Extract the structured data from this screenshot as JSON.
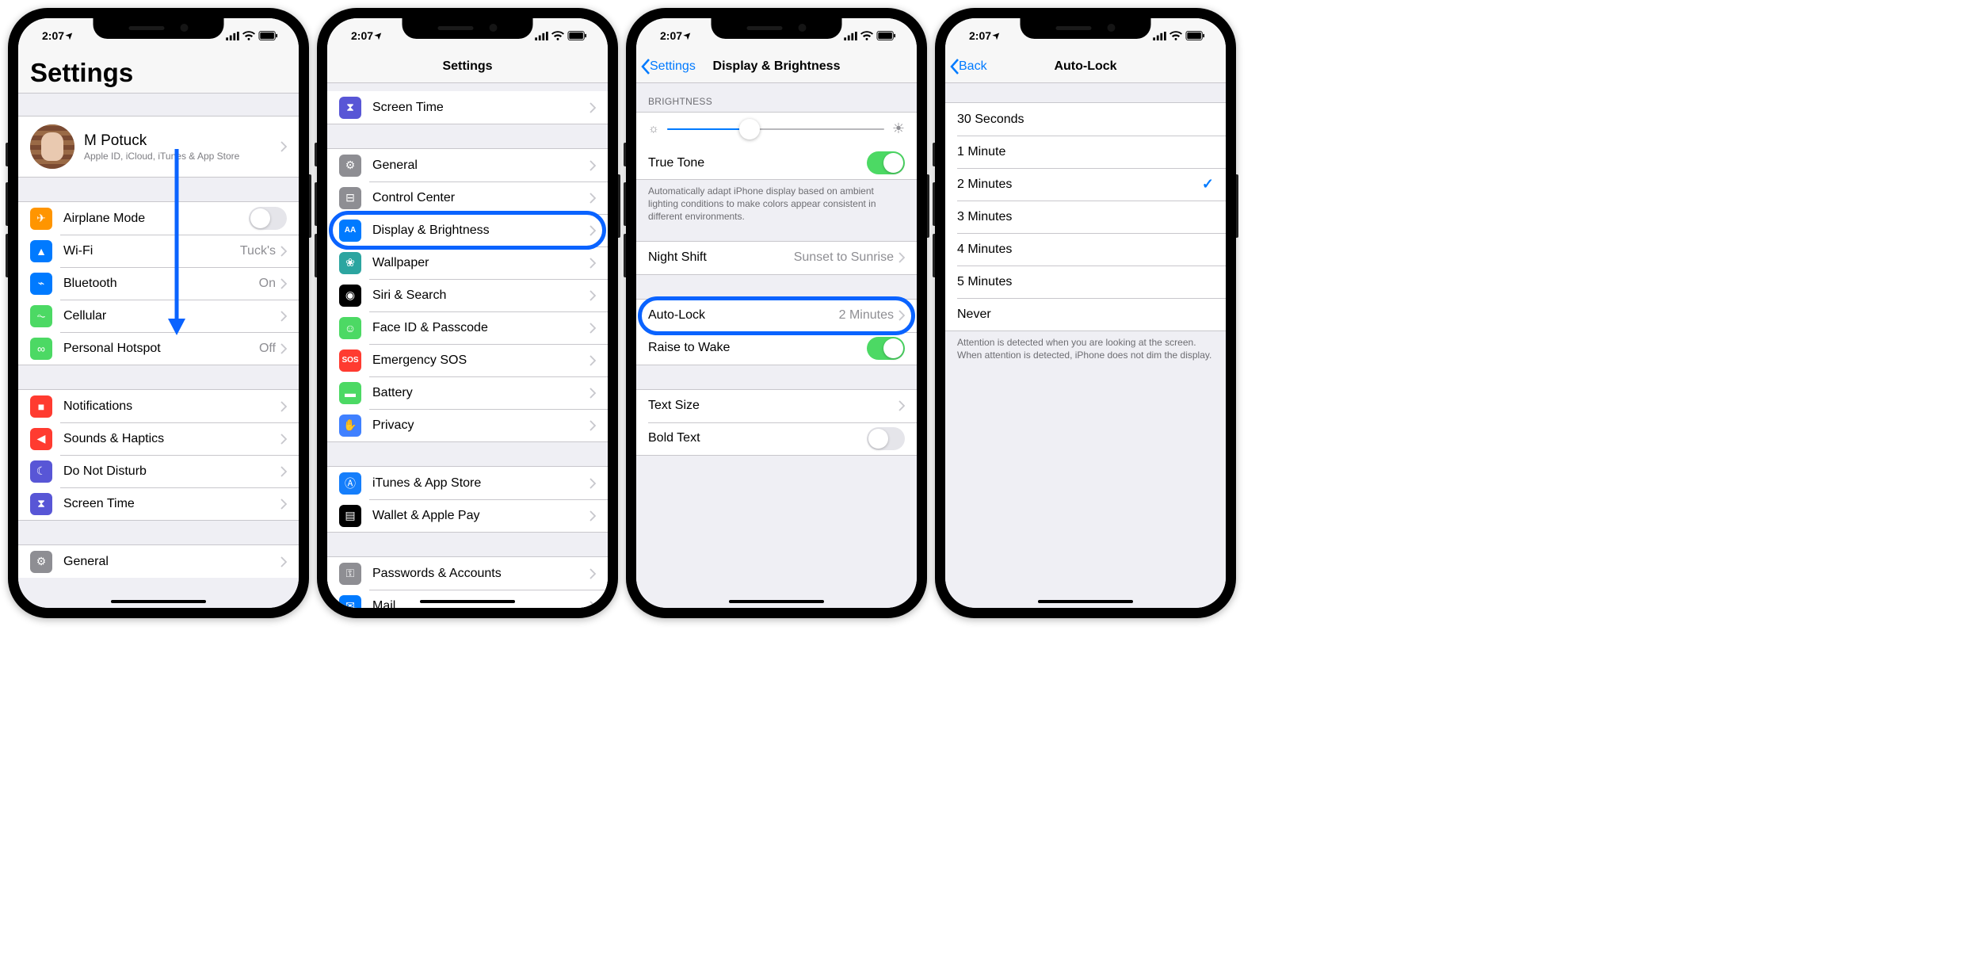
{
  "status": {
    "time": "2:07",
    "wifi": "wifi",
    "battery": "battery"
  },
  "s1": {
    "title": "Settings",
    "profile": {
      "name": "M Potuck",
      "sub": "Apple ID, iCloud, iTunes & App Store"
    },
    "g1": [
      {
        "label": "Airplane Mode",
        "ico": "airplane",
        "c": "c-orange",
        "switch": false
      },
      {
        "label": "Wi-Fi",
        "val": "Tuck's",
        "ico": "wifi",
        "c": "c-blue"
      },
      {
        "label": "Bluetooth",
        "val": "On",
        "ico": "bt",
        "c": "c-blue"
      },
      {
        "label": "Cellular",
        "val": "",
        "ico": "cell",
        "c": "c-green"
      },
      {
        "label": "Personal Hotspot",
        "val": "Off",
        "ico": "link",
        "c": "c-green"
      }
    ],
    "g2": [
      {
        "label": "Notifications",
        "ico": "notif",
        "c": "c-red"
      },
      {
        "label": "Sounds & Haptics",
        "ico": "sound",
        "c": "c-red"
      },
      {
        "label": "Do Not Disturb",
        "ico": "moon",
        "c": "c-purple"
      },
      {
        "label": "Screen Time",
        "ico": "hour",
        "c": "c-indigo"
      }
    ],
    "g3": [
      {
        "label": "General",
        "ico": "gear",
        "c": "c-grey"
      }
    ]
  },
  "s2": {
    "title": "Settings",
    "g0": [
      {
        "label": "Screen Time",
        "ico": "hour",
        "c": "c-indigo"
      }
    ],
    "g1": [
      {
        "label": "General",
        "ico": "gear",
        "c": "c-grey"
      },
      {
        "label": "Control Center",
        "ico": "cc",
        "c": "c-grey"
      },
      {
        "label": "Display & Brightness",
        "ico": "AA",
        "c": "c-blue",
        "hl": true
      },
      {
        "label": "Wallpaper",
        "ico": "wall",
        "c": "c-teal"
      },
      {
        "label": "Siri & Search",
        "ico": "siri",
        "c": "c-black"
      },
      {
        "label": "Face ID & Passcode",
        "ico": "face",
        "c": "c-green"
      },
      {
        "label": "Emergency SOS",
        "ico": "SOS",
        "c": "c-sos"
      },
      {
        "label": "Battery",
        "ico": "batt",
        "c": "c-green"
      },
      {
        "label": "Privacy",
        "ico": "hand",
        "c": "c-hand"
      }
    ],
    "g2": [
      {
        "label": "iTunes & App Store",
        "ico": "A",
        "c": "c-bluebox"
      },
      {
        "label": "Wallet & Apple Pay",
        "ico": "wallet",
        "c": "c-black"
      }
    ],
    "g3": [
      {
        "label": "Passwords & Accounts",
        "ico": "key",
        "c": "c-grey"
      },
      {
        "label": "Mail",
        "ico": "mail",
        "c": "c-blue"
      }
    ]
  },
  "s3": {
    "back": "Settings",
    "title": "Display & Brightness",
    "hdr": "Brightness",
    "truetone": {
      "label": "True Tone",
      "on": true
    },
    "truetone_ftr": "Automatically adapt iPhone display based on ambient lighting conditions to make colors appear consistent in different environments.",
    "nightshift": {
      "label": "Night Shift",
      "val": "Sunset to Sunrise"
    },
    "autolock": {
      "label": "Auto-Lock",
      "val": "2 Minutes",
      "hl": true
    },
    "raise": {
      "label": "Raise to Wake",
      "on": true
    },
    "textsize": {
      "label": "Text Size"
    },
    "bold": {
      "label": "Bold Text",
      "on": false
    }
  },
  "s4": {
    "back": "Back",
    "title": "Auto-Lock",
    "options": [
      "30 Seconds",
      "1 Minute",
      "2 Minutes",
      "3 Minutes",
      "4 Minutes",
      "5 Minutes",
      "Never"
    ],
    "selected": 2,
    "ftr": "Attention is detected when you are looking at the screen. When attention is detected, iPhone does not dim the display."
  }
}
